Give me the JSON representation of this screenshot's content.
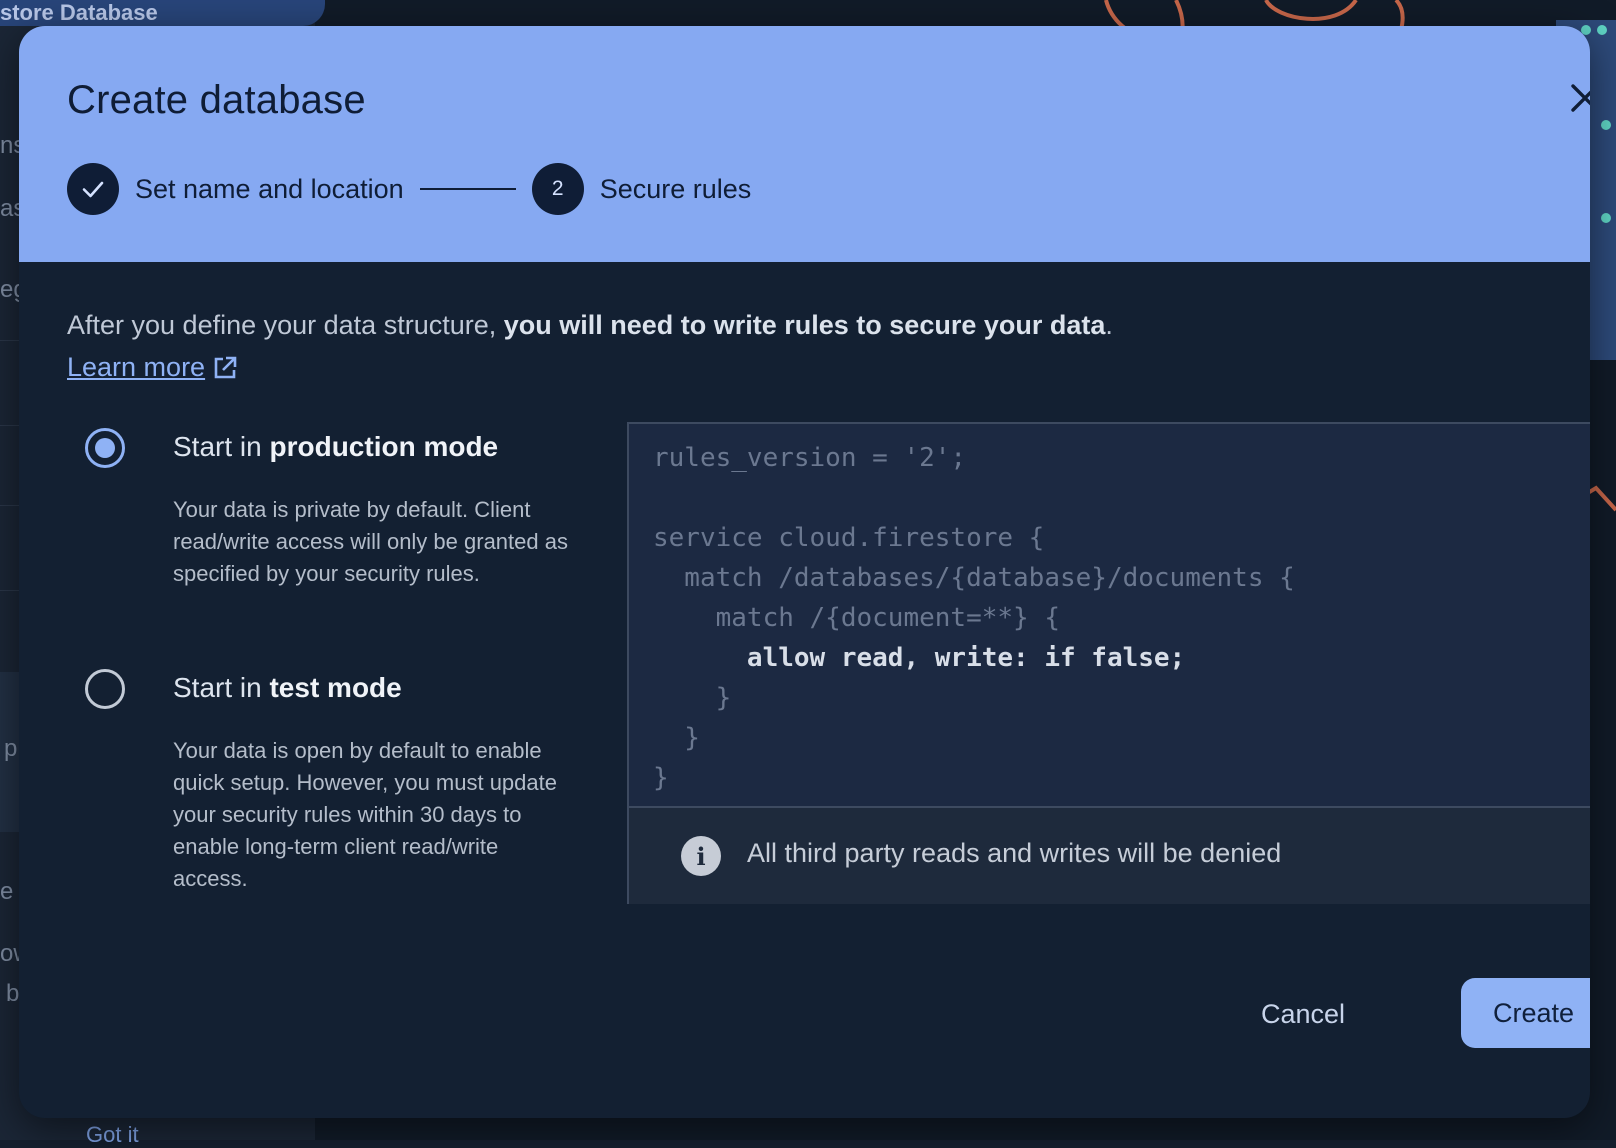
{
  "background": {
    "title_fragment": "store Database",
    "sidebar_fragments": [
      "ns",
      "as",
      "eg",
      "p",
      "e y",
      "ow",
      "b"
    ],
    "got_it": "Got it"
  },
  "dialog": {
    "title": "Create database",
    "close_icon": "close-icon",
    "steps": [
      {
        "status": "completed",
        "icon": "check-icon",
        "label": "Set name and location"
      },
      {
        "status": "active",
        "number": "2",
        "label": "Secure rules"
      }
    ],
    "intro": {
      "text": "After you define your data structure, ",
      "bold": "you will need to write rules to secure your data",
      "end": "."
    },
    "learn_more": "Learn more",
    "options": [
      {
        "selected": true,
        "title_prefix": "Start in ",
        "title_bold": "production mode",
        "description": "Your data is private by default. Client read/write access will only be granted as specified by your security rules."
      },
      {
        "selected": false,
        "title_prefix": "Start in ",
        "title_bold": "test mode",
        "description": "Your data is open by default to enable quick setup. However, you must update your security rules within 30 days to enable long-term client read/write access."
      }
    ],
    "code_lines": [
      "rules_version = '2';",
      "",
      "service cloud.firestore {",
      "  match /databases/{database}/documents {",
      "    match /{document=**} {",
      "      allow read, write: if false;",
      "    }",
      "  }",
      "}"
    ],
    "code_highlight_line": 5,
    "info_text": "All third party reads and writes will be denied",
    "cancel_label": "Cancel",
    "create_label": "Create"
  },
  "colors": {
    "header_bg": "#86a9f2",
    "dialog_bg": "#132032",
    "accent": "#8fb2f5"
  }
}
